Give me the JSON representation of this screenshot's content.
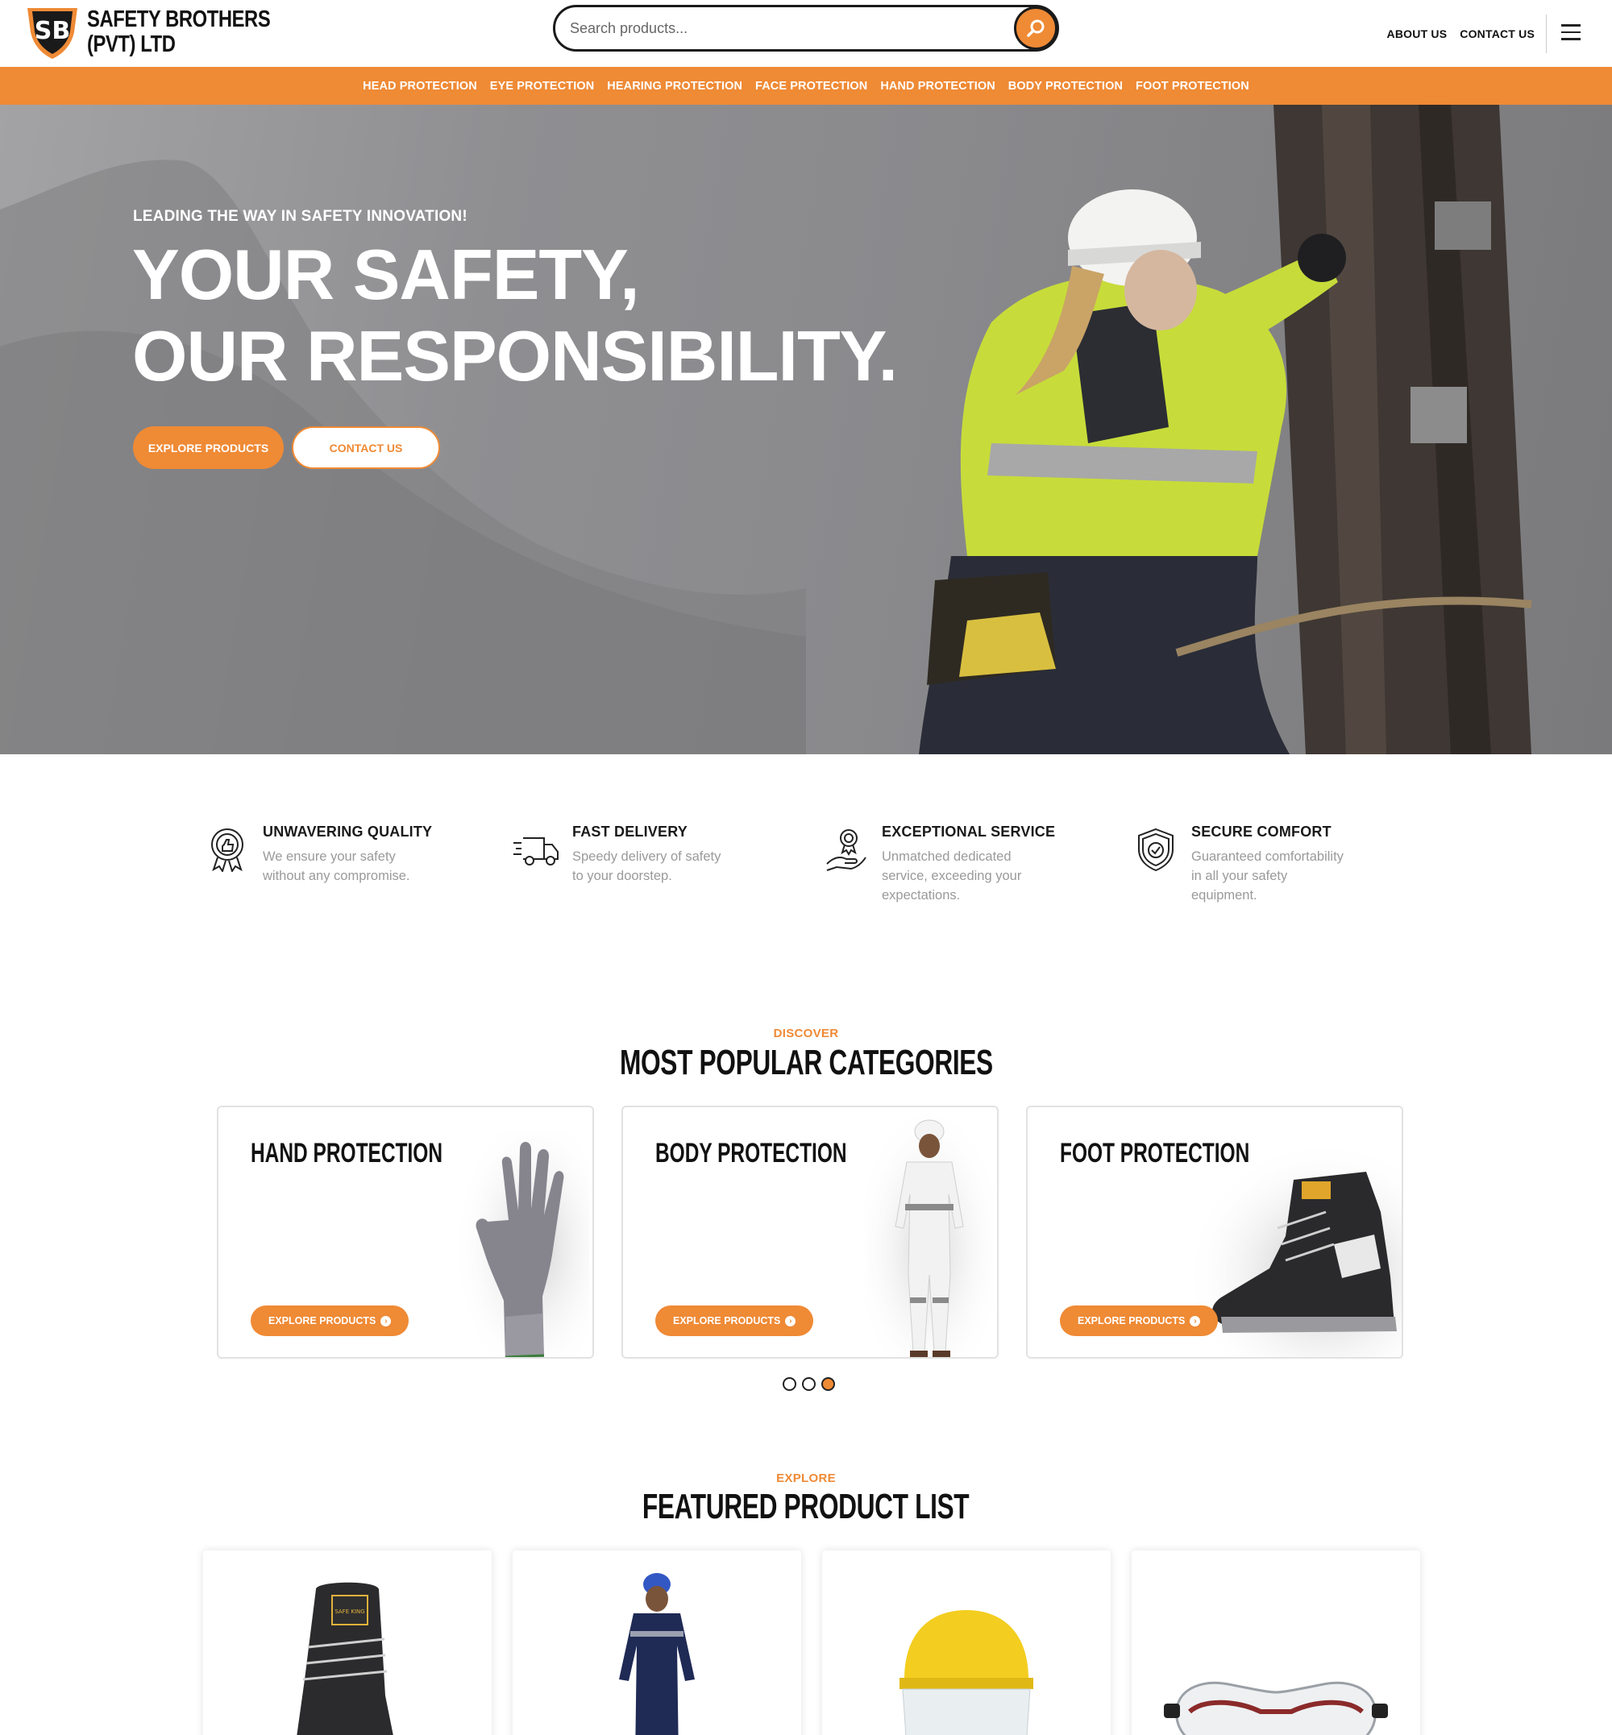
{
  "brand": {
    "name_line1": "SAFETY BROTHERS",
    "name_line2": "(PVT) LTD",
    "monogram": "SB"
  },
  "search": {
    "placeholder": "Search products..."
  },
  "top_nav": {
    "about": "ABOUT US",
    "contact": "CONTACT US"
  },
  "category_nav": [
    "HEAD PROTECTION",
    "EYE PROTECTION",
    "HEARING PROTECTION",
    "FACE PROTECTION",
    "HAND PROTECTION",
    "BODY PROTECTION",
    "FOOT PROTECTION"
  ],
  "hero": {
    "kicker": "LEADING THE WAY IN SAFETY INNOVATION!",
    "title_line1": "YOUR SAFETY,",
    "title_line2": "OUR RESPONSIBILITY.",
    "primary_button": "EXPLORE PRODUCTS",
    "secondary_button": "CONTACT US"
  },
  "features": [
    {
      "icon": "quality-badge-icon",
      "title": "UNWAVERING QUALITY",
      "line1": "We ensure your safety",
      "line2": "without any compromise.",
      "line3": ""
    },
    {
      "icon": "delivery-truck-icon",
      "title": "FAST DELIVERY",
      "line1": "Speedy delivery of safety",
      "line2": "to your doorstep.",
      "line3": ""
    },
    {
      "icon": "service-hand-icon",
      "title": "EXCEPTIONAL SERVICE",
      "line1": "Unmatched dedicated",
      "line2": "service, exceeding your",
      "line3": "expectations."
    },
    {
      "icon": "shield-check-icon",
      "title": "SECURE COMFORT",
      "line1": "Guaranteed comfortability",
      "line2": "in all your safety",
      "line3": "equipment."
    }
  ],
  "categories_section": {
    "kicker": "DISCOVER",
    "title": "MOST POPULAR CATEGORIES",
    "cards": [
      {
        "title": "HAND PROTECTION",
        "button": "EXPLORE PRODUCTS"
      },
      {
        "title": "BODY PROTECTION",
        "button": "EXPLORE PRODUCTS"
      },
      {
        "title": "FOOT PROTECTION",
        "button": "EXPLORE PRODUCTS"
      }
    ],
    "carousel_active_index": 3,
    "carousel_count": 3
  },
  "featured_section": {
    "kicker": "EXPLORE",
    "title": "FEATURED PRODUCT LIST",
    "products": [
      "safety-boot-image",
      "coverall-image",
      "hard-hat-face-shield-image",
      "safety-goggles-image"
    ]
  },
  "colors": {
    "accent": "#ef8a35",
    "text": "#111111",
    "muted": "#9a9a9a"
  }
}
